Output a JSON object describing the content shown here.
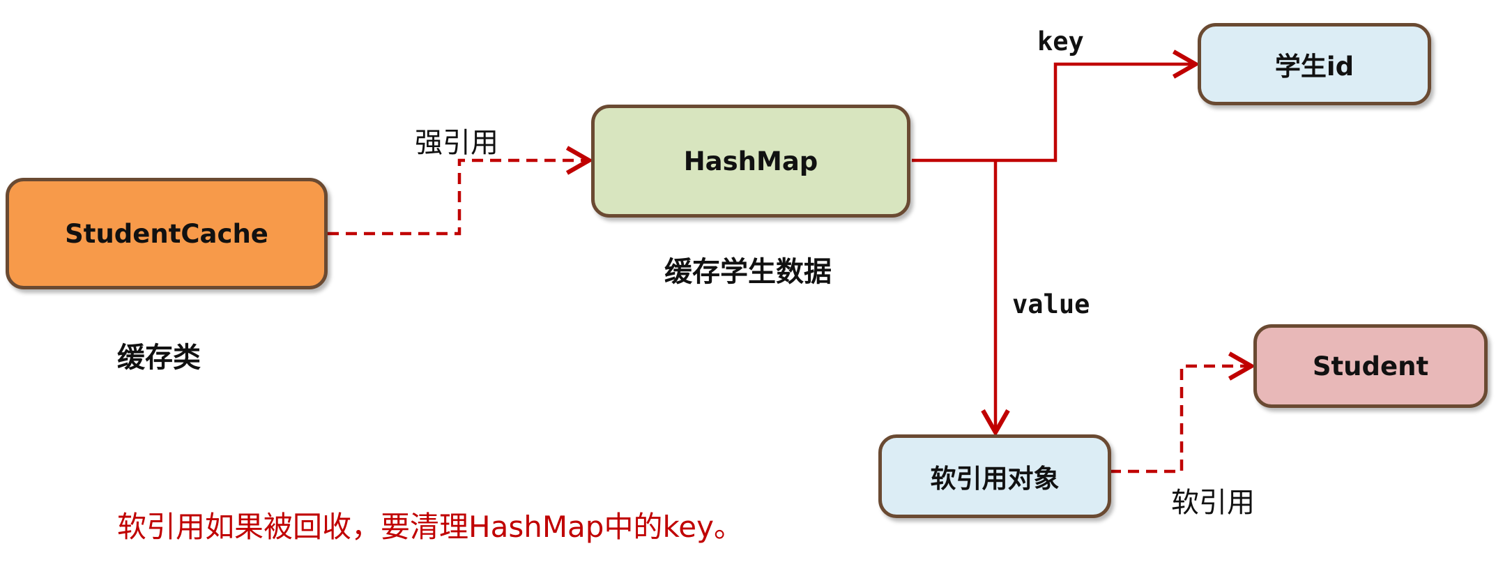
{
  "nodes": {
    "student_cache": {
      "label": "StudentCache",
      "color": "#f79a4a"
    },
    "hashmap": {
      "label": "HashMap",
      "color": "#d8e5bf"
    },
    "student_id": {
      "label": "学生id",
      "color": "#dcedf5"
    },
    "soft_ref_object": {
      "label": "软引用对象",
      "color": "#dcedf5"
    },
    "student": {
      "label": "Student",
      "color": "#e8b8b8"
    }
  },
  "captions": {
    "cache_class": "缓存类",
    "cache_student_data": "缓存学生数据"
  },
  "edges": {
    "strong_ref": "强引用",
    "key": "key",
    "value": "value",
    "soft_ref": "软引用"
  },
  "note": "软引用如果被回收，要清理HashMap中的key。",
  "colors": {
    "edge": "#c00000",
    "border": "#6a4a32"
  }
}
